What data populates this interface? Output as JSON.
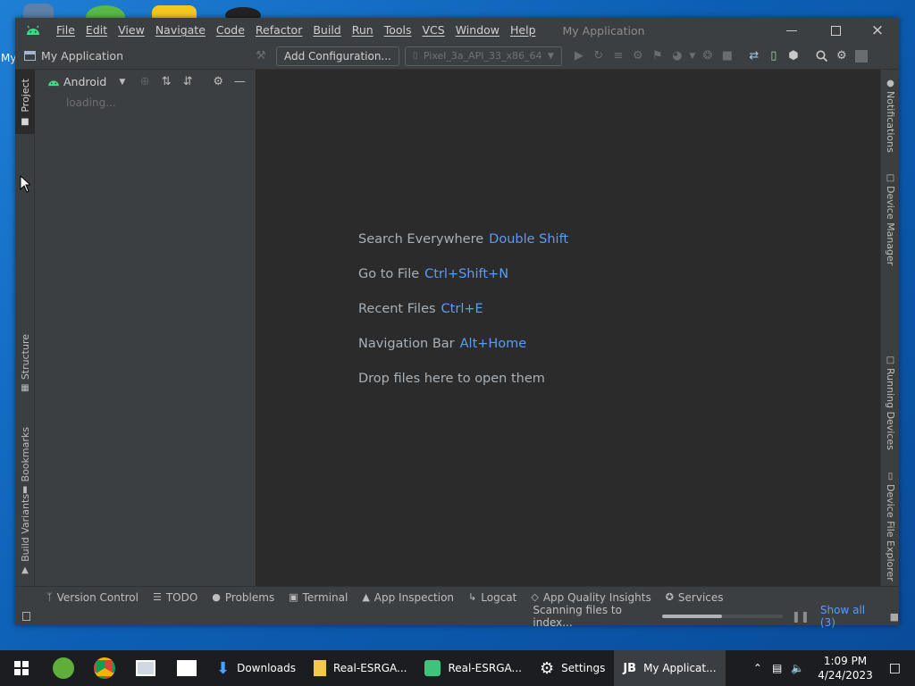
{
  "desktop": {
    "label": "My"
  },
  "window": {
    "title": "My Application",
    "menu": [
      "File",
      "Edit",
      "View",
      "Navigate",
      "Code",
      "Refactor",
      "Build",
      "Run",
      "Tools",
      "VCS",
      "Window",
      "Help"
    ],
    "minimize_icon": "minimize-icon",
    "maximize_icon": "maximize-icon",
    "close_icon": "close-icon"
  },
  "toolbar": {
    "project_name": "My Application",
    "add_config_label": "Add Configuration...",
    "device_label": "Pixel_3a_API_33_x86_64"
  },
  "left_tabs": [
    "Project",
    "Structure",
    "Bookmarks",
    "Build Variants"
  ],
  "right_tabs": [
    "Notifications",
    "Device Manager",
    "Running Devices",
    "Device File Explorer"
  ],
  "project_panel": {
    "view": "Android",
    "status": "loading..."
  },
  "editor": {
    "hints": [
      {
        "text": "Search Everywhere",
        "key": "Double Shift"
      },
      {
        "text": "Go to File",
        "key": "Ctrl+Shift+N"
      },
      {
        "text": "Recent Files",
        "key": "Ctrl+E"
      },
      {
        "text": "Navigation Bar",
        "key": "Alt+Home"
      },
      {
        "text": "Drop files here to open them",
        "key": ""
      }
    ]
  },
  "bottom_tools": [
    "Version Control",
    "TODO",
    "Problems",
    "Terminal",
    "App Inspection",
    "Logcat",
    "App Quality Insights",
    "Services"
  ],
  "status": {
    "text": "Scanning files to index...",
    "progress": 0.5,
    "show_all": "Show all (3)"
  },
  "taskbar": {
    "items": [
      {
        "label": "Downloads"
      },
      {
        "label": "Real-ESRGA..."
      },
      {
        "label": "Real-ESRGA..."
      },
      {
        "label": "Settings"
      },
      {
        "label": "My Applicat..."
      }
    ],
    "time": "1:09 PM",
    "date": "4/24/2023"
  },
  "colors": {
    "accent": "#589df6",
    "android_green": "#3ddc84",
    "ide_bg": "#2b2b2b",
    "panel_bg": "#3c3f41"
  }
}
